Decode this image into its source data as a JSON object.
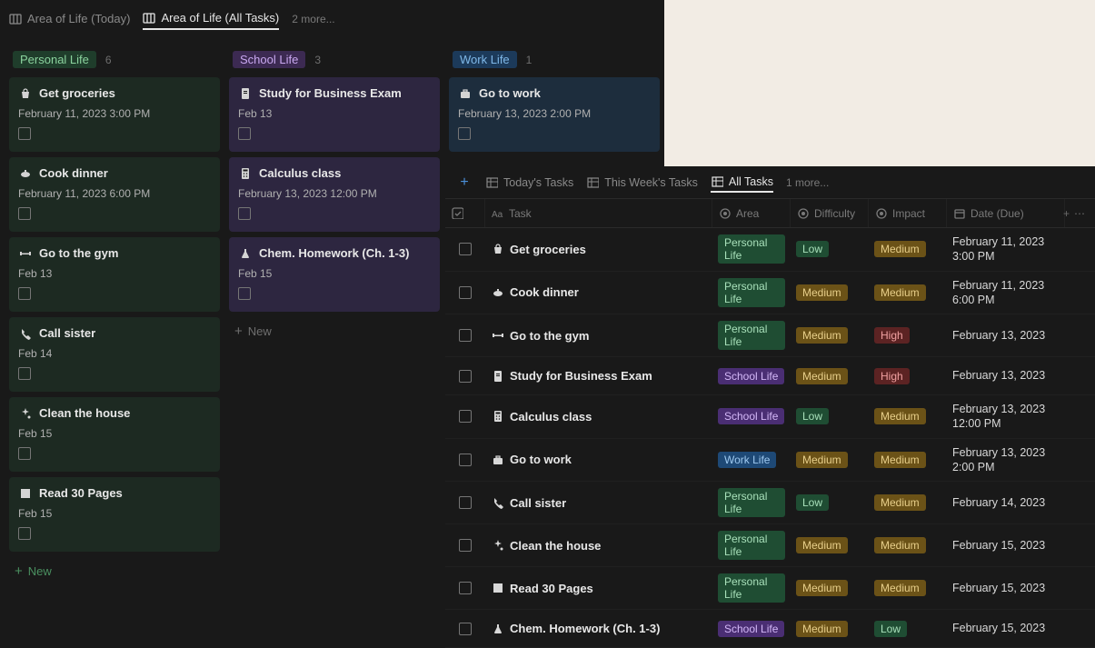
{
  "top_tabs": {
    "today": "Area of Life (Today)",
    "all": "Area of Life (All Tasks)",
    "more": "2 more..."
  },
  "columns": [
    {
      "id": "personal",
      "label": "Personal Life",
      "count": "6",
      "badge_class": "badge-personal",
      "card_class": "card-personal",
      "cards": [
        {
          "icon": "bag",
          "title": "Get groceries",
          "date": "February 11, 2023 3:00 PM"
        },
        {
          "icon": "pot",
          "title": "Cook dinner",
          "date": "February 11, 2023 6:00 PM"
        },
        {
          "icon": "gym",
          "title": "Go to the gym",
          "date": "Feb 13"
        },
        {
          "icon": "phone",
          "title": "Call sister",
          "date": "Feb 14"
        },
        {
          "icon": "sparkle",
          "title": "Clean the house",
          "date": "Feb 15"
        },
        {
          "icon": "book",
          "title": "Read 30 Pages",
          "date": "Feb 15"
        }
      ],
      "new_label": "New",
      "new_class": "green"
    },
    {
      "id": "school",
      "label": "School Life",
      "count": "3",
      "badge_class": "badge-school",
      "card_class": "card-school",
      "cards": [
        {
          "icon": "doc",
          "title": "Study for Business Exam",
          "date": "Feb 13"
        },
        {
          "icon": "calc",
          "title": "Calculus class",
          "date": "February 13, 2023 12:00 PM"
        },
        {
          "icon": "flask",
          "title": "Chem. Homework (Ch. 1-3)",
          "date": "Feb 15"
        }
      ],
      "new_label": "New",
      "new_class": ""
    },
    {
      "id": "work",
      "label": "Work Life",
      "count": "1",
      "badge_class": "badge-work",
      "card_class": "card-work",
      "cards": [
        {
          "icon": "briefcase",
          "title": "Go to work",
          "date": "February 13, 2023 2:00 PM"
        }
      ],
      "new_label": "",
      "new_class": ""
    }
  ],
  "table": {
    "tabs": {
      "today": "Today's Tasks",
      "week": "This Week's Tasks",
      "all": "All Tasks",
      "more": "1 more..."
    },
    "headers": {
      "task": "Task",
      "area": "Area",
      "difficulty": "Difficulty",
      "impact": "Impact",
      "date": "Date (Due)"
    },
    "rows": [
      {
        "icon": "bag",
        "task": "Get groceries",
        "area": "Personal Life",
        "area_cls": "pill-personal",
        "diff": "Low",
        "diff_cls": "pill-low",
        "impact": "Medium",
        "impact_cls": "pill-medium",
        "date": "February 11, 2023 3:00 PM"
      },
      {
        "icon": "pot",
        "task": "Cook dinner",
        "area": "Personal Life",
        "area_cls": "pill-personal",
        "diff": "Medium",
        "diff_cls": "pill-medium",
        "impact": "Medium",
        "impact_cls": "pill-medium",
        "date": "February 11, 2023 6:00 PM"
      },
      {
        "icon": "gym",
        "task": "Go to the gym",
        "area": "Personal Life",
        "area_cls": "pill-personal",
        "diff": "Medium",
        "diff_cls": "pill-medium",
        "impact": "High",
        "impact_cls": "pill-high",
        "date": "February 13, 2023"
      },
      {
        "icon": "doc",
        "task": "Study for Business Exam",
        "area": "School Life",
        "area_cls": "pill-school",
        "diff": "Medium",
        "diff_cls": "pill-medium",
        "impact": "High",
        "impact_cls": "pill-high",
        "date": "February 13, 2023"
      },
      {
        "icon": "calc",
        "task": "Calculus class",
        "area": "School Life",
        "area_cls": "pill-school",
        "diff": "Low",
        "diff_cls": "pill-low",
        "impact": "Medium",
        "impact_cls": "pill-medium",
        "date": "February 13, 2023 12:00 PM"
      },
      {
        "icon": "briefcase",
        "task": "Go to work",
        "area": "Work Life",
        "area_cls": "pill-work",
        "diff": "Medium",
        "diff_cls": "pill-medium",
        "impact": "Medium",
        "impact_cls": "pill-medium",
        "date": "February 13, 2023 2:00 PM"
      },
      {
        "icon": "phone",
        "task": "Call sister",
        "area": "Personal Life",
        "area_cls": "pill-personal",
        "diff": "Low",
        "diff_cls": "pill-low",
        "impact": "Medium",
        "impact_cls": "pill-medium",
        "date": "February 14, 2023"
      },
      {
        "icon": "sparkle",
        "task": "Clean the house",
        "area": "Personal Life",
        "area_cls": "pill-personal",
        "diff": "Medium",
        "diff_cls": "pill-medium",
        "impact": "Medium",
        "impact_cls": "pill-medium",
        "date": "February 15, 2023"
      },
      {
        "icon": "book",
        "task": "Read 30 Pages",
        "area": "Personal Life",
        "area_cls": "pill-personal",
        "diff": "Medium",
        "diff_cls": "pill-medium",
        "impact": "Medium",
        "impact_cls": "pill-medium",
        "date": "February 15, 2023"
      },
      {
        "icon": "flask",
        "task": "Chem. Homework (Ch. 1-3)",
        "area": "School Life",
        "area_cls": "pill-school",
        "diff": "Medium",
        "diff_cls": "pill-medium",
        "impact": "Low",
        "impact_cls": "pill-low",
        "date": "February 15, 2023"
      }
    ]
  }
}
